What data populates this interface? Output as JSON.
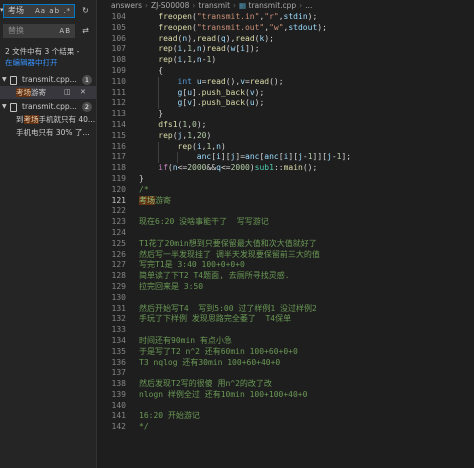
{
  "search": {
    "query": "考场",
    "query_options": "Aa ab .*",
    "replace_placeholder": "替换",
    "replace_options": "AB",
    "result_summary": "2 文件中有 3 个结果 -",
    "open_in_editor": "在编辑器中打开"
  },
  "results": {
    "files": [
      {
        "name": "transmit.cpp...",
        "count": "1"
      },
      {
        "name": "transmit.cpp...",
        "count": "2"
      }
    ],
    "match1": {
      "pre": "",
      "hit": "考场",
      "post": "游寄"
    },
    "match2": {
      "pre": "到",
      "hit": "考场",
      "post": "手机就只有 40..."
    },
    "match3": {
      "text": "手机电只有 30% 了..."
    }
  },
  "breadcrumb": {
    "parts": [
      "answers",
      "ZJ-S00008",
      "transmit",
      "transmit.cpp",
      "..."
    ]
  },
  "code": {
    "lines": [
      {
        "n": "104",
        "t": "    freopen(\"transmit.in\",\"r\",stdin);"
      },
      {
        "n": "105",
        "t": "    freopen(\"transmit.out\",\"w\",stdout);"
      },
      {
        "n": "106",
        "t": "    read(n),read(q),read(k);"
      },
      {
        "n": "107",
        "t": "    rep(i,1,n)read(w[i]);"
      },
      {
        "n": "108",
        "t": "    rep(i,1,n-1)"
      },
      {
        "n": "109",
        "t": "    {"
      },
      {
        "n": "110",
        "t": "        int u=read(),v=read();"
      },
      {
        "n": "111",
        "t": "        g[u].push_back(v);"
      },
      {
        "n": "112",
        "t": "        g[v].push_back(u);"
      },
      {
        "n": "113",
        "t": "    }"
      },
      {
        "n": "114",
        "t": "    dfs1(1,0);"
      },
      {
        "n": "115",
        "t": "    rep(j,1,20)"
      },
      {
        "n": "116",
        "t": "        rep(i,1,n)"
      },
      {
        "n": "117",
        "t": "            anc[i][j]=anc[anc[i][j-1]][j-1];"
      },
      {
        "n": "118",
        "t": "    if(n<=2000&&q<=2000)sub1::main();"
      },
      {
        "n": "119",
        "t": "}"
      },
      {
        "n": "120",
        "t": "/*"
      },
      {
        "n": "121",
        "t": "考场游寄"
      },
      {
        "n": "122",
        "t": ""
      },
      {
        "n": "123",
        "t": "现在6:20 没啥事能干了  写写游记"
      },
      {
        "n": "124",
        "t": ""
      },
      {
        "n": "125",
        "t": "T1花了20min想到只要保留最大值和次大值就好了"
      },
      {
        "n": "126",
        "t": "然后写一半发现挂了 调半天发现要保留前三大的值"
      },
      {
        "n": "127",
        "t": "写完T1是 3:40 100+0+0+0"
      },
      {
        "n": "128",
        "t": "简单读了下T2 T4题面, 去厕所寻找灵感."
      },
      {
        "n": "129",
        "t": "拉完回来是 3:50"
      },
      {
        "n": "130",
        "t": ""
      },
      {
        "n": "131",
        "t": "然后开始写T4  写到5:00 过了样例1 没过样例2"
      },
      {
        "n": "132",
        "t": "手玩了下样例 发现思路完全萎了  T4保单"
      },
      {
        "n": "133",
        "t": ""
      },
      {
        "n": "134",
        "t": "时间还有90min 有点小急"
      },
      {
        "n": "135",
        "t": "于是写了T2 n^2 还有60min 100+60+0+0"
      },
      {
        "n": "136",
        "t": "T3 nqlog 还有30min 100+60+40+0"
      },
      {
        "n": "137",
        "t": ""
      },
      {
        "n": "138",
        "t": "然后发现T2写的很傻 用n^2的改了改"
      },
      {
        "n": "139",
        "t": "nlogn 样例全过 还有10min 100+100+40+0"
      },
      {
        "n": "140",
        "t": ""
      },
      {
        "n": "141",
        "t": "16:20 开始游记"
      },
      {
        "n": "142",
        "t": "*/"
      }
    ]
  },
  "colors": {
    "editor_bg": "#1e1e1e",
    "sidebar_bg": "#252526",
    "comment": "#6a9955",
    "keyword": "#569cd6",
    "string": "#ce9178",
    "match_highlight": "#613214",
    "link": "#3794ff"
  }
}
